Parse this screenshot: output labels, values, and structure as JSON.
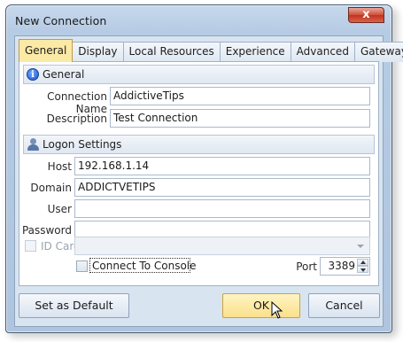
{
  "window": {
    "title": "New Connection",
    "close_glyph": "x"
  },
  "tabs": [
    {
      "label": "General",
      "active": true
    },
    {
      "label": "Display",
      "active": false
    },
    {
      "label": "Local Resources",
      "active": false
    },
    {
      "label": "Experience",
      "active": false
    },
    {
      "label": "Advanced",
      "active": false
    },
    {
      "label": "Gateway",
      "active": false
    }
  ],
  "general": {
    "header": "General",
    "icon": "info-icon",
    "connection_name_label": "Connection Name",
    "connection_name_value": "AddictiveTips",
    "description_label": "Description",
    "description_value": "Test Connection"
  },
  "logon": {
    "header": "Logon Settings",
    "icon": "user-icon",
    "host_label": "Host",
    "host_value": "192.168.1.14",
    "domain_label": "Domain",
    "domain_value": "ADDICTVETIPS",
    "user_label": "User",
    "user_value": "",
    "password_label": "Password",
    "password_value": "",
    "id_card_label": "ID Card",
    "id_card_value": "",
    "connect_console_label": "Connect To Console",
    "port_label": "Port",
    "port_value": "3389"
  },
  "footer": {
    "set_default_label": "Set as Default",
    "ok_label": "OK",
    "cancel_label": "Cancel"
  },
  "colors": {
    "active_tab": "#fbe9a6",
    "window_frame": "#b6cbe4",
    "close_button": "#c2341f"
  }
}
